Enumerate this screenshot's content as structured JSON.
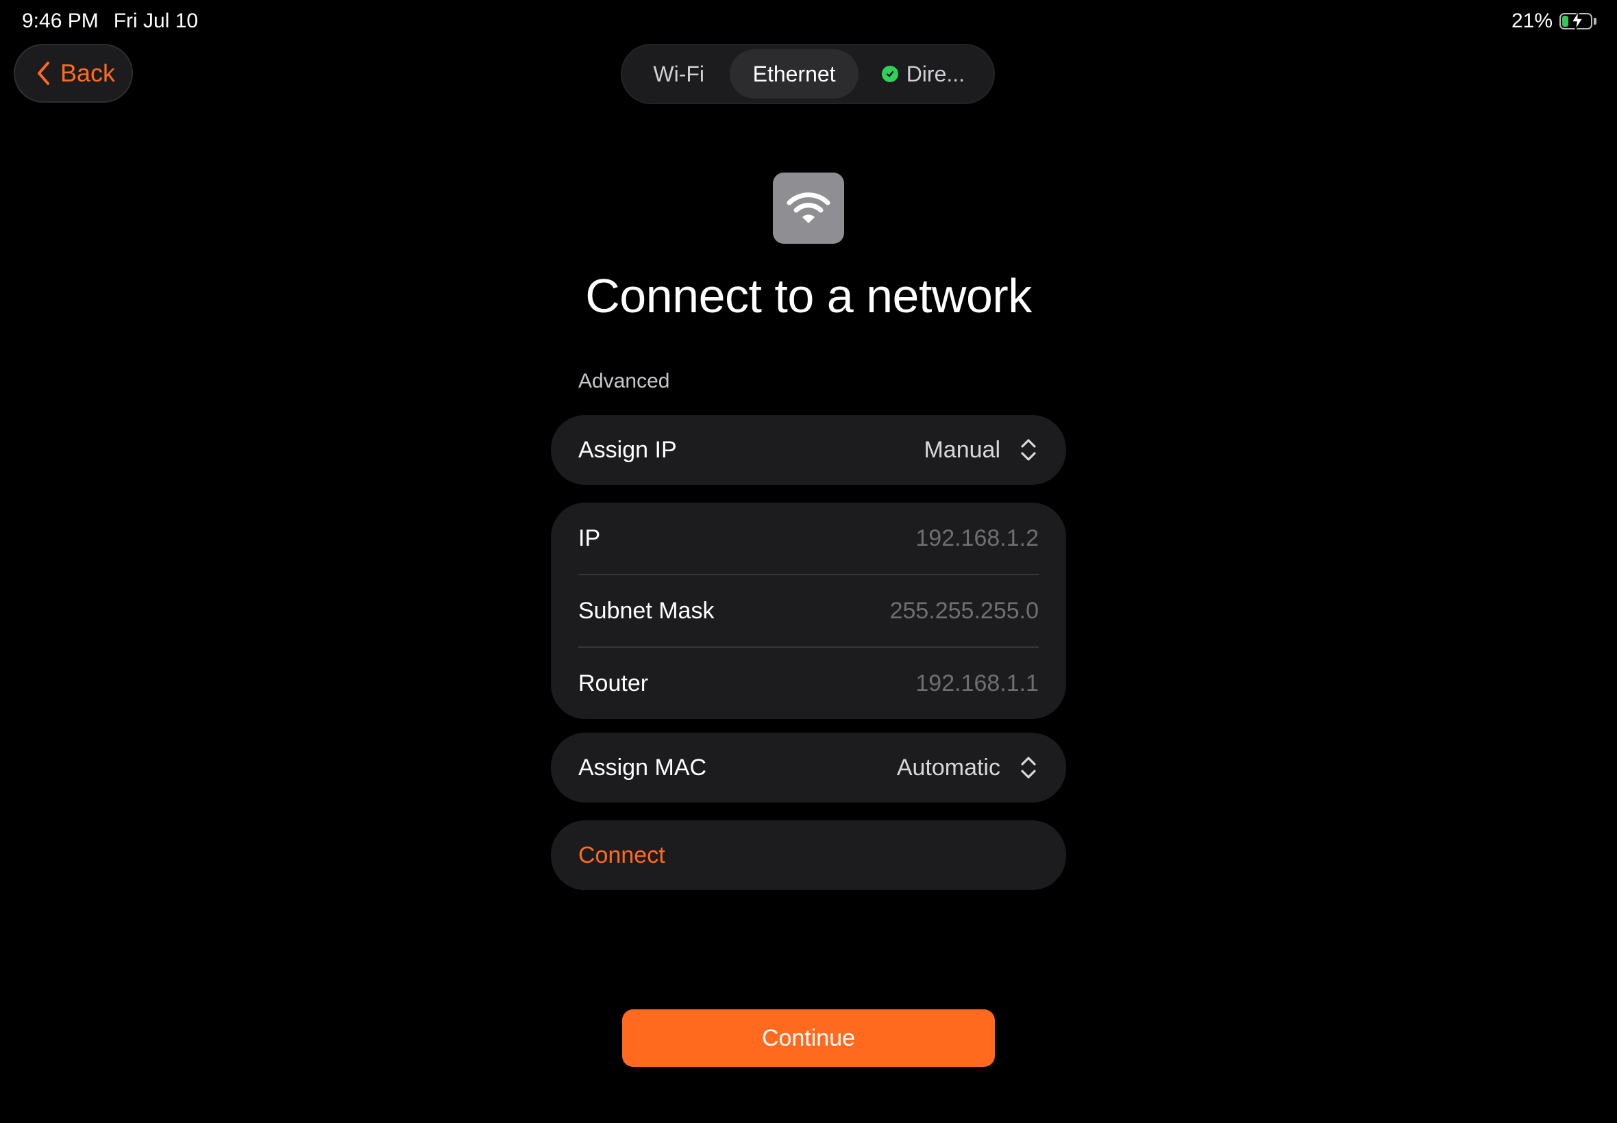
{
  "status_bar": {
    "time": "9:46 PM",
    "date": "Fri Jul 10",
    "battery_percent": "21%",
    "battery_level": 0.21
  },
  "header": {
    "back_label": "Back"
  },
  "tabs": [
    {
      "label": "Wi-Fi",
      "selected": false
    },
    {
      "label": "Ethernet",
      "selected": true
    },
    {
      "label": "Dire...",
      "selected": false,
      "status": "connected"
    }
  ],
  "main": {
    "icon": "wifi-icon",
    "title": "Connect to a network",
    "section_label": "Advanced",
    "assign_ip": {
      "label": "Assign IP",
      "value": "Manual"
    },
    "ip_fields": [
      {
        "label": "IP",
        "placeholder": "192.168.1.2"
      },
      {
        "label": "Subnet Mask",
        "placeholder": "255.255.255.0"
      },
      {
        "label": "Router",
        "placeholder": "192.168.1.1"
      }
    ],
    "assign_mac": {
      "label": "Assign MAC",
      "value": "Automatic"
    },
    "connect_label": "Connect",
    "continue_label": "Continue"
  },
  "colors": {
    "accent": "#ff6a1f",
    "card_bg": "#1c1c1e",
    "success": "#30d158"
  }
}
